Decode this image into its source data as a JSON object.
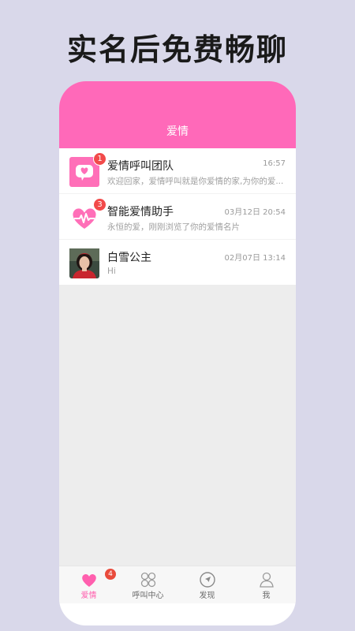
{
  "headline": "实名后免费畅聊",
  "nav": {
    "title": "爱情"
  },
  "conversations": [
    {
      "name": "爱情呼叫团队",
      "time": "16:57",
      "preview": "欢迎回家，爱情呼叫就是你爱情的家,为你的爱...",
      "badge": "1",
      "icon": "chat-bubble-heart-icon"
    },
    {
      "name": "智能爱情助手",
      "time": "03月12日 20:54",
      "preview": "永恒的爱，刚刚浏览了你的爱情名片",
      "badge": "3",
      "icon": "heart-pulse-icon"
    },
    {
      "name": "白雪公主",
      "time": "02月07日 13:14",
      "preview": "Hi",
      "badge": "",
      "icon": "user-avatar-photo"
    }
  ],
  "tabs": [
    {
      "label": "爱情",
      "icon": "heart-icon",
      "badge": "4",
      "active": true
    },
    {
      "label": "呼叫中心",
      "icon": "grid-circles-icon",
      "active": false
    },
    {
      "label": "发现",
      "icon": "compass-icon",
      "active": false
    },
    {
      "label": "我",
      "icon": "person-icon",
      "active": false
    }
  ],
  "colors": {
    "accent": "#ff69b9",
    "badge": "#f24a4a",
    "background": "#d9d8ea"
  }
}
